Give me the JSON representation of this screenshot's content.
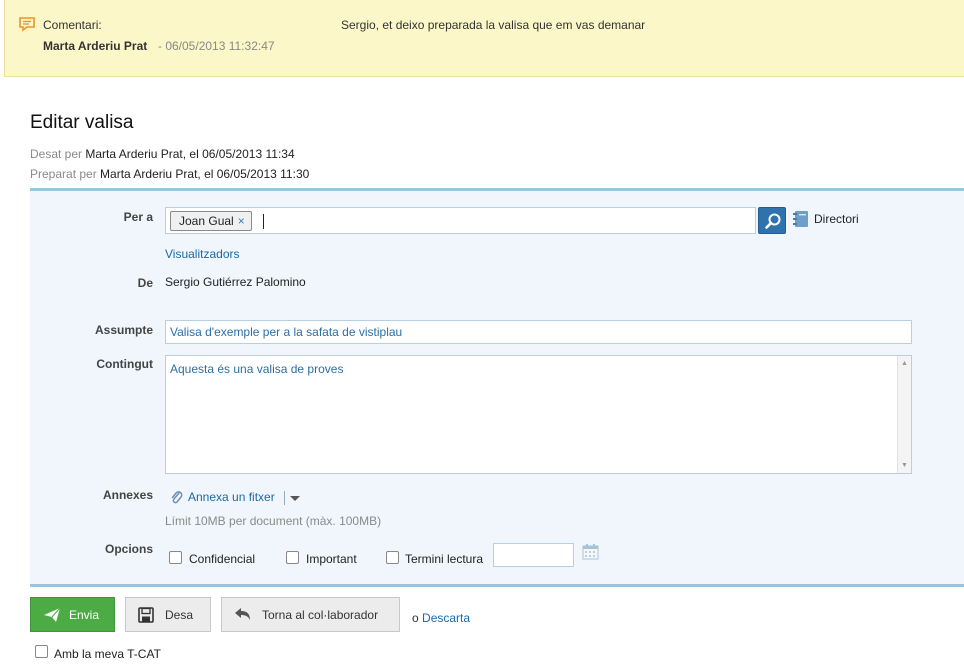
{
  "comment": {
    "label": "Comentari:",
    "author": "Marta Arderiu Prat",
    "date": "- 06/05/2013 11:32:47",
    "text": "Sergio, et deixo preparada la valisa que em vas demanar"
  },
  "page": {
    "title": "Editar valisa",
    "saved_prefix": "Desat per",
    "saved_value": "Marta Arderiu Prat, el 06/05/2013 11:34",
    "prepared_prefix": "Preparat per",
    "prepared_value": "Marta Arderiu Prat, el 06/05/2013 11:30"
  },
  "form": {
    "to_label": "Per a",
    "to_token": "Joan Gual",
    "token_remove": "×",
    "directory_label": "Directori",
    "viewers_link": "Visualitzadors",
    "from_label": "De",
    "from_value": "Sergio Gutiérrez Palomino",
    "subject_label": "Assumpte",
    "subject_value": "Valisa d'exemple per a la safata de vistiplau",
    "content_label": "Contingut",
    "content_value": "Aquesta és una valisa de proves",
    "attachments_label": "Annexes",
    "attach_link": "Annexa un fitxer",
    "attach_hint": "Límit 10MB per document (màx. 100MB)",
    "options_label": "Opcions",
    "options": {
      "confidential": "Confidencial",
      "important": "Important",
      "deadline": "Termini lectura"
    }
  },
  "actions": {
    "send": "Envia",
    "save": "Desa",
    "return": "Torna al col·laborador",
    "discard_prefix": "o",
    "discard": "Descarta"
  },
  "footer": {
    "tcat_label": "Amb la meva T-CAT"
  },
  "colors": {
    "comment_bg": "#fcf7c8",
    "form_bg": "#f0f6fb",
    "accent_border": "#9cc4e0",
    "link": "#1a6aa8",
    "send_button": "#4cab45",
    "search_button": "#2f72ad"
  },
  "icons": [
    "comment-icon",
    "search-icon",
    "directory-icon",
    "paperclip-icon",
    "chevron-down-icon",
    "calendar-icon",
    "paper-plane-icon",
    "floppy-disk-icon",
    "undo-icon"
  ]
}
